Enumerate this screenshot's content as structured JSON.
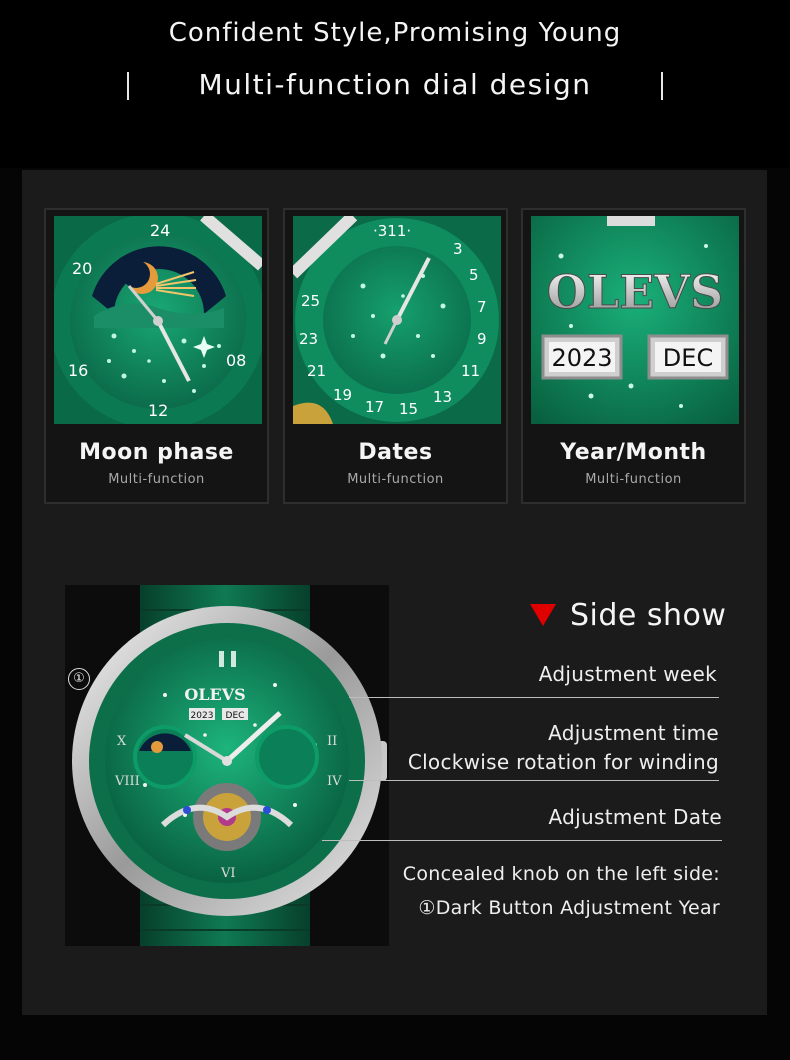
{
  "header": {
    "title": "Confident Style,Promising Young",
    "subtitle": "Multi-function dial design"
  },
  "features": [
    {
      "title": "Moon phase",
      "subtitle": "Multi-function",
      "dial_numbers": [
        "24",
        "20",
        "16",
        "12",
        "08"
      ]
    },
    {
      "title": "Dates",
      "subtitle": "Multi-function",
      "dial_numbers": [
        "31",
        "1",
        "3",
        "5",
        "7",
        "9",
        "11",
        "13",
        "15",
        "17",
        "19",
        "21",
        "23",
        "25"
      ]
    },
    {
      "title": "Year/Month",
      "subtitle": "Multi-function",
      "brand": "OLEVS",
      "year": "2023",
      "month": "DEC"
    }
  ],
  "side_show": {
    "title": "Side show",
    "marker": "①",
    "labels": {
      "week": "Adjustment week",
      "time": "Adjustment time",
      "winding": "Clockwise rotation for winding",
      "date": "Adjustment Date",
      "knob": "Concealed knob on the left side:",
      "year": "①Dark Button Adjustment Year"
    }
  },
  "watch": {
    "brand": "OLEVS",
    "year": "2023",
    "month": "DEC"
  },
  "colors": {
    "accent": "#e00000",
    "dial": "#0f8a5f",
    "background": "#1b1b1b"
  }
}
